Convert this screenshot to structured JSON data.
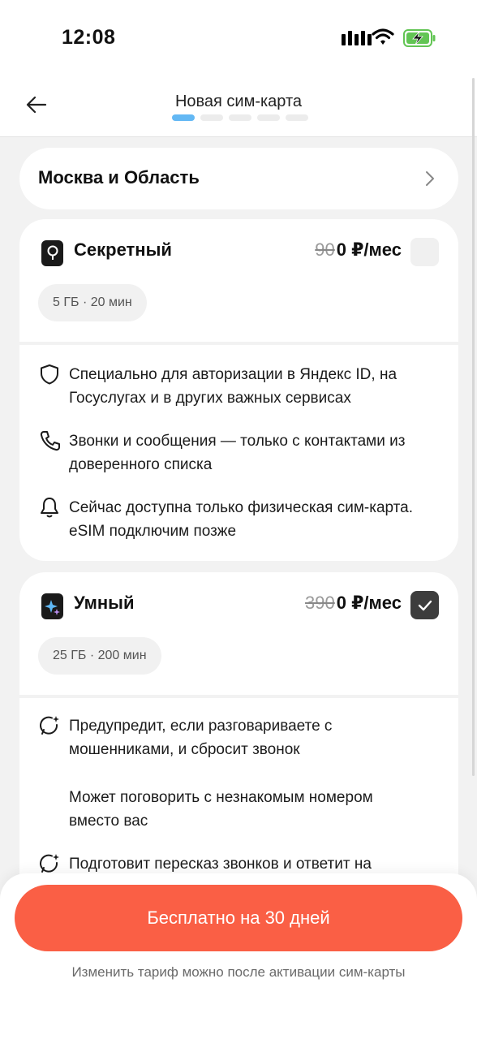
{
  "status_bar": {
    "time": "12:08"
  },
  "header": {
    "title": "Новая сим-карта",
    "steps_total": 5,
    "step_current": 1
  },
  "region": {
    "label": "Москва и Область"
  },
  "plans": [
    {
      "name": "Секретный",
      "old_price": "90",
      "price": "0 ₽/мес",
      "selected": false,
      "allowance": "5 ГБ · 20 мин",
      "features": [
        {
          "icon": "shield-icon",
          "text": "Специально для авторизации в Яндекс ID, на Госуслугах и в других важных сервисах"
        },
        {
          "icon": "phone-icon",
          "text": "Звонки и сообщения — только с контактами из доверенного списка"
        },
        {
          "icon": "bell-icon",
          "text": "Сейчас доступна только физическая сим-карта. eSIM подключим позже"
        }
      ]
    },
    {
      "name": "Умный",
      "old_price": "390",
      "price": "0 ₽/мес",
      "selected": true,
      "allowance": "25 ГБ · 200 мин",
      "features": [
        {
          "icon": "sparkle-chat-icon",
          "text": "Предупредит, если разговариваете с мошенниками, и сбросит звонок"
        },
        {
          "icon": "",
          "text": "Может поговорить с незнакомым номером вместо вас"
        },
        {
          "icon": "sparkle-chat-icon",
          "text": "Подготовит пересказ звонков и ответит на"
        }
      ]
    }
  ],
  "cta": {
    "label": "Бесплатно на 30 дней"
  },
  "footer_note": "Изменить тариф можно после активации сим-карты",
  "colors": {
    "accent": "#fa5f45",
    "step_active": "#63b8f4",
    "checkbox_on": "#3d3d3d"
  }
}
